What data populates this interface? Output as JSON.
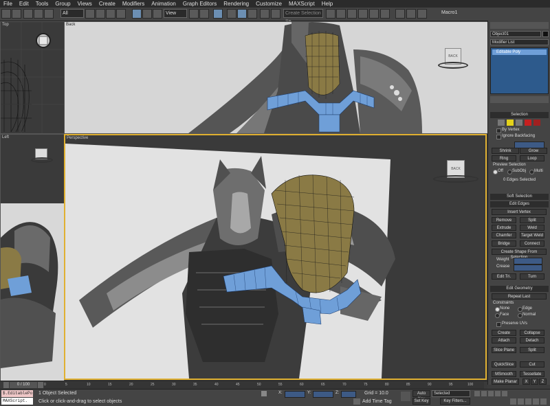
{
  "menu": [
    "File",
    "Edit",
    "Tools",
    "Group",
    "Views",
    "Create",
    "Modifiers",
    "Animation",
    "Graph Editors",
    "Rendering",
    "Customize",
    "MAXScript",
    "Help"
  ],
  "toolbar": {
    "filter_value": "All",
    "refcoord_value": "View",
    "named_selection_placeholder": "Create Selection Se",
    "macro_label": "Macro1"
  },
  "viewports": {
    "top": {
      "label": "Top"
    },
    "back": {
      "label": "Back",
      "cube_label": "BACK"
    },
    "left": {
      "label": "Left"
    },
    "perspective": {
      "label": "Perspective",
      "cube_label": "BACK"
    }
  },
  "command_panel": {
    "object_name": "Object01",
    "modifier_list_label": "Modifier List",
    "stack_item": "Editable Poly",
    "selection": {
      "title": "Selection",
      "by_vertex": "By Vertex",
      "ignore_backfacing": "Ignore Backfacing",
      "shrink": "Shrink",
      "grow": "Grow",
      "ring": "Ring",
      "loop": "Loop",
      "preview_selection": "Preview Selection",
      "off": "Off",
      "subobj": "SubObj",
      "multi": "Multi",
      "status": "0 Edges Selected"
    },
    "soft_selection": {
      "title": "Soft Selection"
    },
    "edit_edges": {
      "title": "Edit Edges",
      "insert_vertex": "Insert Vertex",
      "remove": "Remove",
      "split": "Split",
      "extrude": "Extrude",
      "weld": "Weld",
      "chamfer": "Chamfer",
      "target_weld": "Target Weld",
      "bridge": "Bridge",
      "connect": "Connect",
      "create_shape": "Create Shape From Selection",
      "weight": "Weight",
      "crease": "Crease",
      "edit_tri": "Edit Tri.",
      "turn": "Turn"
    },
    "edit_geometry": {
      "title": "Edit Geometry",
      "repeat_last": "Repeat Last",
      "constraints": "Constraints",
      "none": "None",
      "edge": "Edge",
      "face": "Face",
      "normal": "Normal",
      "preserve_uvs": "Preserve UVs",
      "create": "Create",
      "collapse": "Collapse",
      "attach": "Attach",
      "detach": "Detach",
      "slice_plane": "Slice Plane",
      "split": "Split",
      "quickslice": "QuickSlice",
      "cut": "Cut",
      "msmooth": "MSmooth",
      "tessellate": "Tessellate",
      "make_planar": "Make Planar",
      "x": "X",
      "y": "Y",
      "z": "Z"
    }
  },
  "timeline": {
    "frame_counter": "0 / 100",
    "ticks": [
      "0",
      "5",
      "10",
      "15",
      "20",
      "25",
      "30",
      "35",
      "40",
      "45",
      "50",
      "55",
      "60",
      "65",
      "70",
      "75",
      "80",
      "85",
      "90",
      "95",
      "100"
    ]
  },
  "status": {
    "script_output": "$.EditablePo",
    "maxscript_label": "MAXScript.",
    "selection_info": "1 Object Selected",
    "prompt": "Click or click-and-drag to select objects",
    "x_label": "X:",
    "y_label": "Y:",
    "z_label": "Z:",
    "grid": "Grid = 10.0",
    "add_time_tag": "Add Time Tag",
    "auto_key": "Auto Key",
    "set_key": "Set Key",
    "selected_value": "Selected",
    "key_filters": "Key Filters..."
  },
  "colors": {
    "selection_blue": "#6f9fd8",
    "mesh_gold": "#8a7a45",
    "panel_bg": "#444444",
    "stack_bg": "#2d5a8c"
  }
}
